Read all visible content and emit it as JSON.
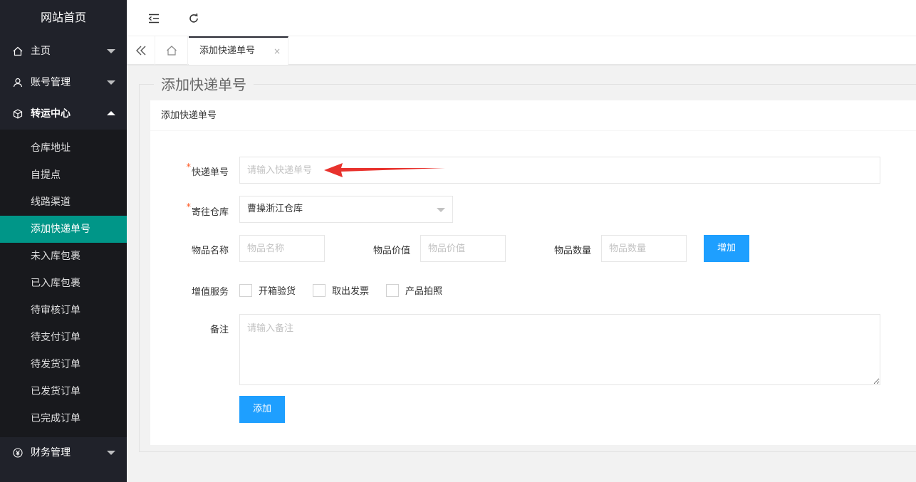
{
  "sidebar": {
    "brand": "网站首页",
    "items": [
      {
        "label": "主页",
        "icon": "home-icon"
      },
      {
        "label": "账号管理",
        "icon": "user-icon"
      },
      {
        "label": "转运中心",
        "icon": "cube-icon"
      }
    ],
    "subitems": [
      "仓库地址",
      "自提点",
      "线路渠道",
      "添加快递单号",
      "未入库包裹",
      "已入库包裹",
      "待审核订单",
      "待支付订单",
      "待发货订单",
      "已发货订单",
      "已完成订单"
    ],
    "bottom_item": {
      "label": "财务管理",
      "icon": "yen-icon"
    },
    "active_color": "#009688"
  },
  "tabs": {
    "active": "添加快递单号",
    "close": "×"
  },
  "page": {
    "legend": "添加快递单号",
    "card_title": "添加快递单号"
  },
  "form": {
    "tracking_label": "快递单号",
    "tracking_placeholder": "请输入快递单号",
    "warehouse_label": "寄往仓库",
    "warehouse_value": "曹操浙江仓库",
    "item_name_label": "物品名称",
    "item_name_placeholder": "物品名称",
    "item_value_label": "物品价值",
    "item_value_placeholder": "物品价值",
    "item_qty_label": "物品数量",
    "item_qty_placeholder": "物品数量",
    "add_row_button": "增加",
    "services_label": "增值服务",
    "services": [
      "开箱验货",
      "取出发票",
      "产品拍照"
    ],
    "remark_label": "备注",
    "remark_placeholder": "请输入备注",
    "submit_button": "添加",
    "required_mark": "*",
    "button_color": "#1e9fff"
  }
}
